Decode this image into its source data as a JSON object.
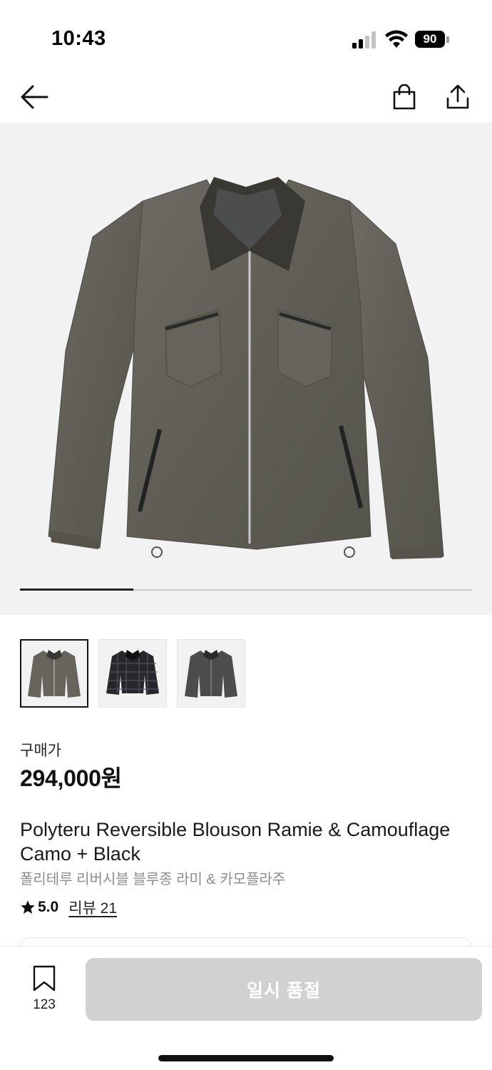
{
  "status_bar": {
    "time": "10:43",
    "battery_level": "90",
    "signal_icon": "cellular-signal-icon",
    "wifi_icon": "wifi-icon"
  },
  "nav": {
    "back_icon": "back-arrow-icon",
    "bag_icon": "shopping-bag-icon",
    "share_icon": "share-icon"
  },
  "gallery": {
    "image_count": 3,
    "current_index": 1,
    "progress_fraction": 0.25,
    "thumbnails": [
      {
        "name": "camo-jacket",
        "active": true
      },
      {
        "name": "plaid-jacket",
        "active": false
      },
      {
        "name": "black-side-jacket",
        "active": false
      }
    ]
  },
  "product": {
    "price_label": "구매가",
    "price": "294,000원",
    "title_en": "Polyteru Reversible Blouson Ramie & Camouflage Camo + Black",
    "title_ko": "폴리테루 리버시블 블루종 라미 & 카모플라주",
    "rating": "5.0",
    "review_label": "리뷰 21"
  },
  "bottom_bar": {
    "bookmark_count": "123",
    "buy_button_label": "일시 품절"
  },
  "colors": {
    "accent": "#111111",
    "disabled_button": "#d1d1d1",
    "hero_background": "#f2f2f2",
    "secondary_text": "#8c8c8c"
  }
}
